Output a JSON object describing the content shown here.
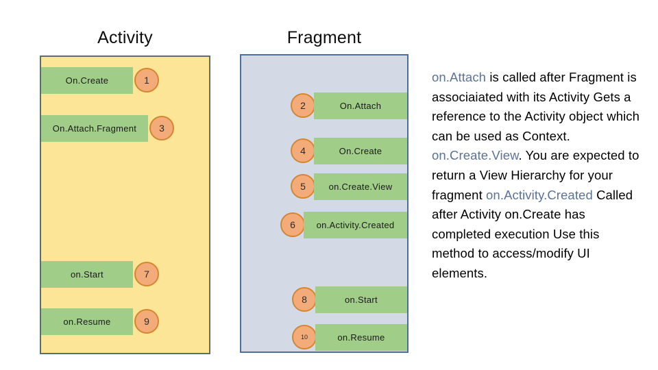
{
  "columns": {
    "activity": {
      "title": "Activity",
      "background_color": "#fce596",
      "border_color": "#5a6e6b",
      "steps": [
        {
          "label": "On.Create",
          "number": "1"
        },
        {
          "label": "On.Attach.Fragment",
          "number": "3"
        },
        {
          "label": "on.Start",
          "number": "7"
        },
        {
          "label": "on.Resume",
          "number": "9"
        }
      ]
    },
    "fragment": {
      "title": "Fragment",
      "background_color": "#d3dae5",
      "border_color": "#4a7099",
      "steps": [
        {
          "label": "On.Attach",
          "number": "2"
        },
        {
          "label": "On.Create",
          "number": "4"
        },
        {
          "label": "on.Create.View",
          "number": "5"
        },
        {
          "label": "on.Activity.Created",
          "number": "6"
        },
        {
          "label": "on.Start",
          "number": "8"
        },
        {
          "label": "on.Resume",
          "number": "10"
        }
      ]
    }
  },
  "style_colors": {
    "bar_green": "#a0cd87",
    "badge_fill": "#f4ab7a",
    "badge_border": "#d4862f",
    "api_accent": "#5b7394"
  },
  "description": {
    "segments": [
      {
        "text": "on.Attach",
        "accent": true
      },
      {
        "text": "  is called after Fragment is associaiated with its Activity Gets a reference to the Activity object which can be used as Context. ",
        "accent": false
      },
      {
        "text": "on.Create.View",
        "accent": true
      },
      {
        "text": ". You are expected to return a View Hierarchy for your fragment ",
        "accent": false
      },
      {
        "text": "on.Activity.Created",
        "accent": true
      },
      {
        "text": "  Called after Activity on.Create has completed execution Use this method to access/modify UI elements.",
        "accent": false
      }
    ]
  }
}
